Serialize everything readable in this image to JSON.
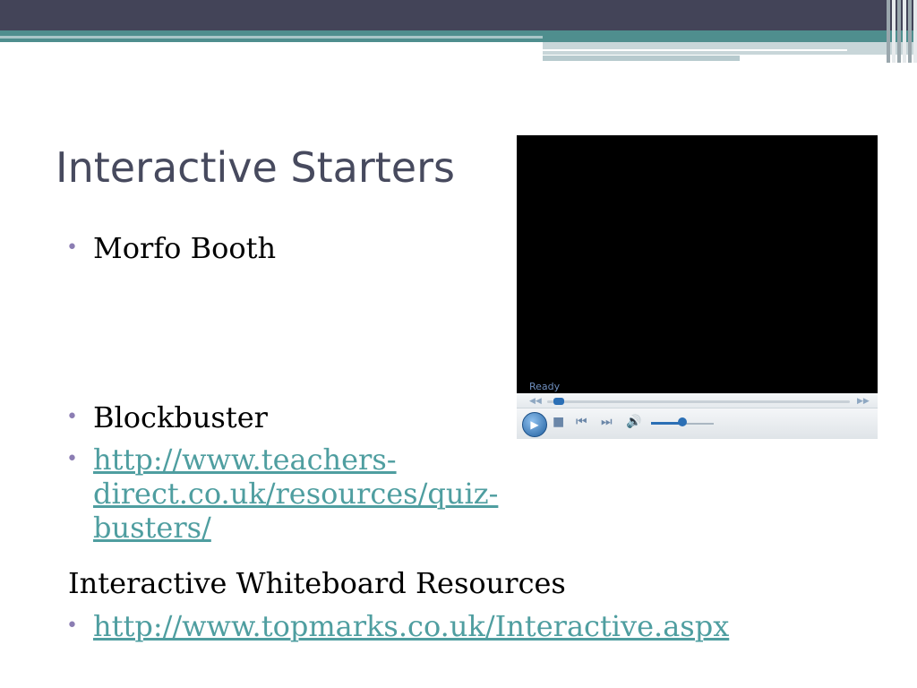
{
  "slide": {
    "title": "Interactive Starters",
    "items": [
      {
        "text": "Morfo Booth"
      },
      {
        "text": "Blockbuster"
      },
      {
        "link": "http://www.teachers-direct.co.uk/resources/quiz-busters/"
      }
    ],
    "section_heading": "Interactive Whiteboard Resources",
    "section_link": "http://www.topmarks.co.uk/Interactive.aspx"
  },
  "player": {
    "status": "Ready",
    "icons": [
      "rewind-icon",
      "play-icon",
      "stop-icon",
      "previous-icon",
      "next-icon",
      "volume-icon",
      "fast-forward-icon"
    ],
    "seek_progress": 0.02,
    "volume": 0.5
  },
  "colors": {
    "title": "#474a5e",
    "bullet": "#8b7db3",
    "link": "#4f9ea0",
    "header_dark": "#434458",
    "header_teal": "#4f8e8e"
  }
}
